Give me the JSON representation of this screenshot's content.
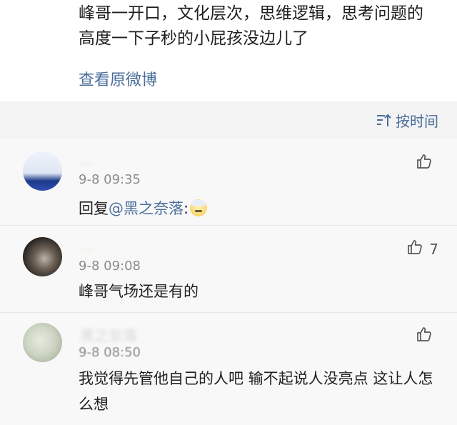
{
  "post": {
    "text": "峰哥一开口，文化层次，思维逻辑，思考问题的高度一下子秒的小屁孩没边儿了",
    "view_original": "查看原微博"
  },
  "sort": {
    "label": "按时间",
    "icon": "sort-icon"
  },
  "comments": [
    {
      "username": "...",
      "time": "9-8 09:35",
      "reply_prefix": "回复",
      "mention": "@黑之奈落",
      "after_mention": ":",
      "emoji": "emoji-face",
      "likes": ""
    },
    {
      "username": "...",
      "time": "9-8 09:08",
      "text": "峰哥气场还是有的",
      "likes": "7"
    },
    {
      "username": "黑之奈落",
      "time": "9-8 08:50",
      "text": "我觉得先管他自己的人吧 输不起说人没亮点 这让人怎么想",
      "likes": ""
    }
  ],
  "colors": {
    "link": "#4a6e9a",
    "text": "#1f1f1f",
    "muted": "#8c8c8c",
    "band": "#f3f3f3"
  }
}
